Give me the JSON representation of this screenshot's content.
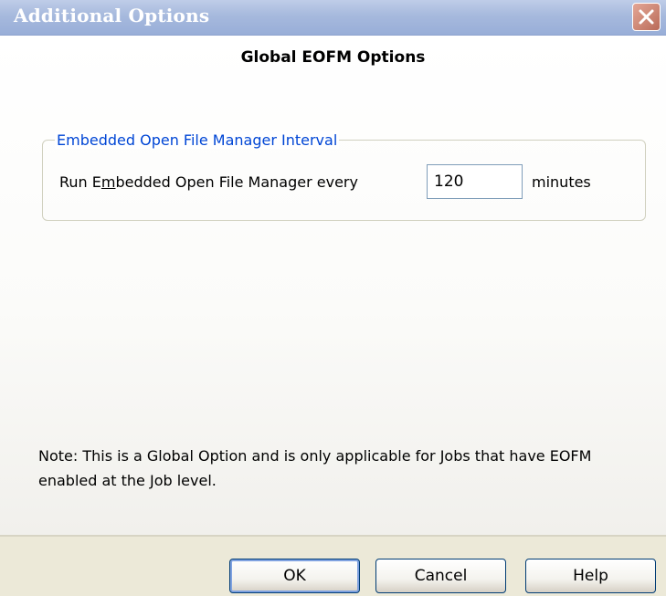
{
  "window": {
    "title": "Additional Options",
    "close_icon": "close-icon"
  },
  "dialog": {
    "heading": "Global EOFM Options",
    "group": {
      "legend": "Embedded Open File Manager Interval",
      "run_label_pre": "Run E",
      "run_label_accel": "m",
      "run_label_post": "bedded Open File Manager every",
      "interval_value": "120",
      "unit_label": "minutes"
    },
    "note": "Note: This is a Global Option and is only applicable for Jobs that have EOFM enabled at the Job level."
  },
  "buttons": {
    "ok": "OK",
    "cancel": "Cancel",
    "help": "Help"
  },
  "colors": {
    "titlebar": "#a6b9dd",
    "legend_text": "#0046d5",
    "close_button": "#cf8a78",
    "face": "#ece9d8"
  }
}
